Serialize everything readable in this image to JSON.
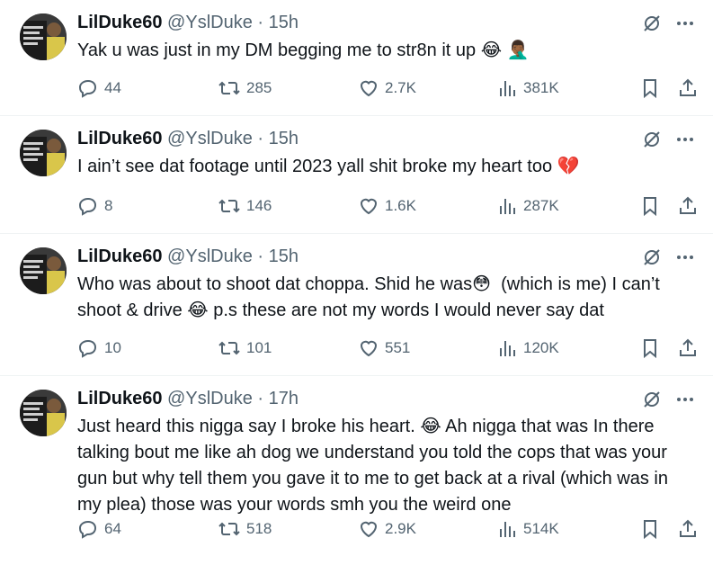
{
  "tweets": [
    {
      "name": "LilDuke60",
      "handle": "@YslDuke",
      "dot": "·",
      "time": "15h",
      "text": "Yak u was just in my DM begging me to str8n it up 😂 🤦🏾‍♂️",
      "replies": "44",
      "retweets": "285",
      "likes": "2.7K",
      "views": "381K"
    },
    {
      "name": "LilDuke60",
      "handle": "@YslDuke",
      "dot": "·",
      "time": "15h",
      "text": "I ain’t see dat footage until 2023 yall shit broke my heart too 💔",
      "replies": "8",
      "retweets": "146",
      "likes": "1.6K",
      "views": "287K"
    },
    {
      "name": "LilDuke60",
      "handle": "@YslDuke",
      "dot": "·",
      "time": "15h",
      "text": "Who was about to shoot dat choppa. Shid he was😳  (which is me) I can’t shoot & drive 😂 p.s these are not my words I would never say dat",
      "replies": "10",
      "retweets": "101",
      "likes": "551",
      "views": "120K"
    },
    {
      "name": "LilDuke60",
      "handle": "@YslDuke",
      "dot": "·",
      "time": "17h",
      "text": "Just heard this nigga say I broke his heart. 😂 Ah nigga that was In there talking bout me like ah dog we understand you told the cops that was your gun but why tell them you gave it to me to get back at a rival (which was in my plea) those was your words smh you the weird one",
      "replies": "64",
      "retweets": "518",
      "likes": "2.9K",
      "views": "514K"
    }
  ],
  "icons": {
    "reply": "reply-icon",
    "retweet": "retweet-icon",
    "like": "heart-icon",
    "views": "views-icon",
    "bookmark": "bookmark-icon",
    "share": "share-icon",
    "grok": "grok-icon",
    "more": "more-icon"
  },
  "colors": {
    "text": "#0f1419",
    "muted": "#536471",
    "divider": "#eff3f4"
  }
}
